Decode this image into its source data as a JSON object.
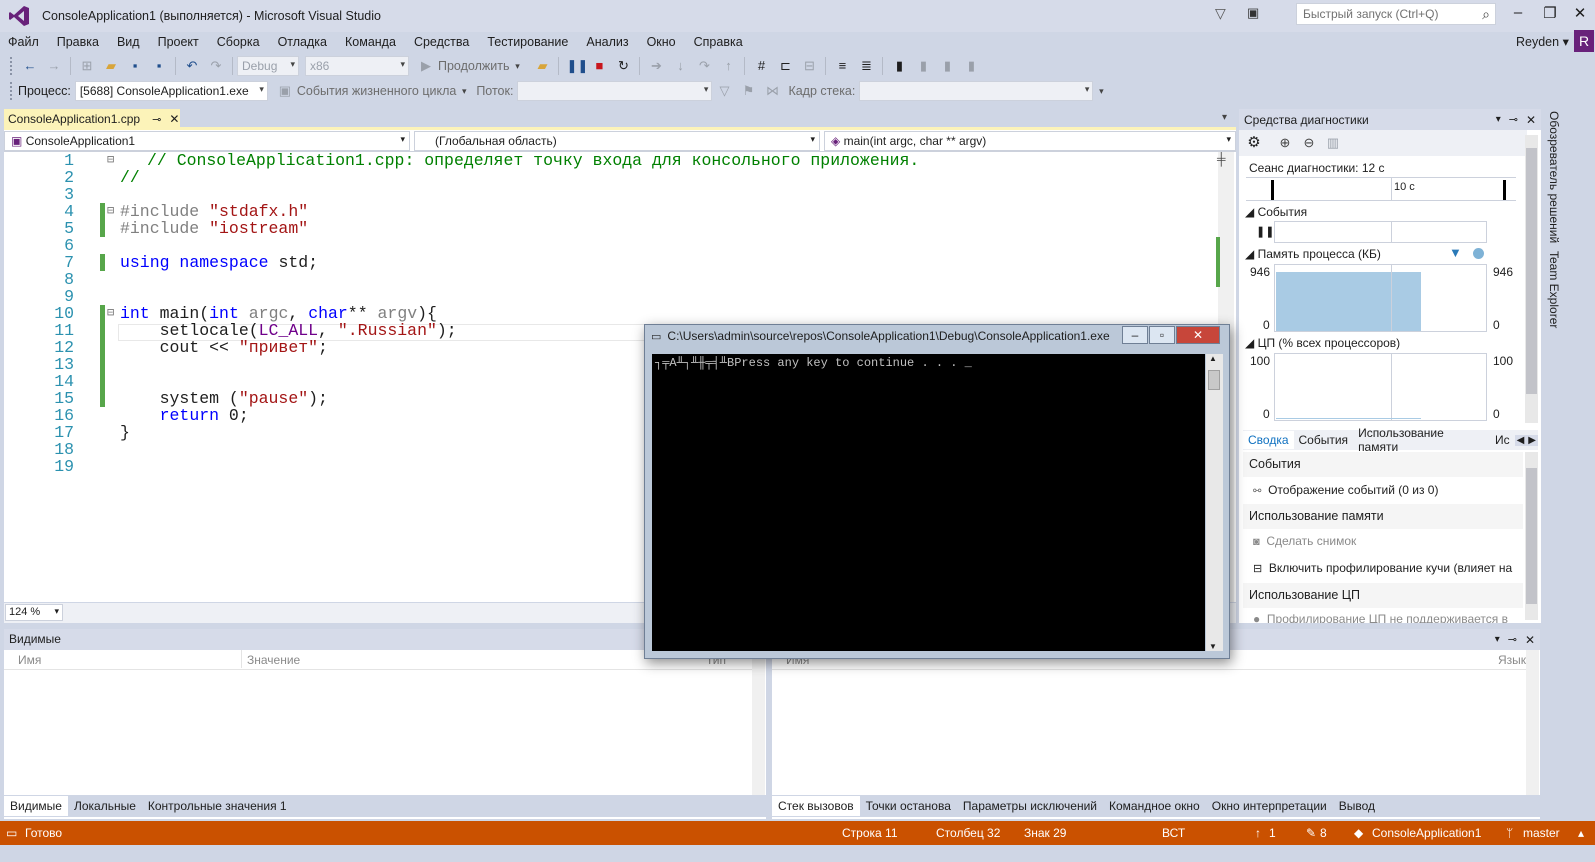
{
  "window": {
    "title": "ConsoleApplication1 (выполняется) - Microsoft Visual Studio",
    "quick_launch_placeholder": "Быстрый запуск (Ctrl+Q)",
    "user": "Reyden",
    "user_initial": "R"
  },
  "menu": [
    "Файл",
    "Правка",
    "Вид",
    "Проект",
    "Сборка",
    "Отладка",
    "Команда",
    "Средства",
    "Тестирование",
    "Анализ",
    "Окно",
    "Справка"
  ],
  "toolbar": {
    "config": "Debug",
    "platform": "x86",
    "continue_label": "Продолжить"
  },
  "debug_location": {
    "process_label": "Процесс:",
    "process_value": "[5688] ConsoleApplication1.exe",
    "lifecycle_label": "События жизненного цикла",
    "thread_label": "Поток:",
    "stack_frame_label": "Кадр стека:"
  },
  "editor": {
    "tab_title": "ConsoleApplication1.cpp",
    "project_combo": "ConsoleApplication1",
    "scope_combo": "(Глобальная область)",
    "member_combo": "main(int argc, char ** argv)",
    "zoom": "124 %",
    "line_numbers": [
      "1",
      "2",
      "3",
      "4",
      "5",
      "6",
      "7",
      "8",
      "9",
      "10",
      "11",
      "12",
      "13",
      "14",
      "15",
      "16",
      "17",
      "18",
      "19"
    ]
  },
  "diagnostics": {
    "title": "Средства диагностики",
    "session": "Сеанс диагностики: 12 с",
    "timeline_tick": "10 с",
    "events_section": "События",
    "memory_section": "Память процесса (КБ)",
    "memory_max_left": "946",
    "memory_min_left": "0",
    "memory_max_right": "946",
    "memory_min_right": "0",
    "memory_fill_fraction": 0.9,
    "cpu_section": "ЦП (% всех процессоров)",
    "cpu_max_left": "100",
    "cpu_min_left": "0",
    "cpu_max_right": "100",
    "cpu_min_right": "0",
    "tabs": [
      "Сводка",
      "События",
      "Использование памяти",
      "Ис"
    ],
    "summary": {
      "events_header": "События",
      "events_item": "Отображение событий (0 из 0)",
      "memory_header": "Использование памяти",
      "snapshot": "Сделать снимок",
      "heap_profiling": "Включить профилирование кучи (влияет на",
      "cpu_header": "Использование ЦП",
      "cpu_note": "Профилирование ЦП не поддерживается в"
    }
  },
  "sidebar": {
    "solution_explorer": "Обозреватель решений",
    "team_explorer": "Team Explorer"
  },
  "locals_panel": {
    "title": "Видимые",
    "col_name": "Имя",
    "col_value": "Значение",
    "col_type": "Тип",
    "tabs": [
      "Видимые",
      "Локальные",
      "Контрольные значения 1"
    ]
  },
  "callstack_panel": {
    "col_name": "Имя",
    "col_lang": "Язык",
    "tabs": [
      "Стек вызовов",
      "Точки останова",
      "Параметры исключений",
      "Командное окно",
      "Окно интерпретации",
      "Вывод"
    ]
  },
  "status": {
    "ready": "Готово",
    "line": "Строка 11",
    "col": "Столбец 32",
    "ch": "Знак 29",
    "mode": "ВСТ",
    "up": "1",
    "edits": "8",
    "repo": "ConsoleApplication1",
    "branch": "master"
  },
  "console": {
    "title": "C:\\Users\\admin\\source\\repos\\ConsoleApplication1\\Debug\\ConsoleApplication1.exe",
    "output": "┐╤A╨┐╨╫╤╡╨BPress any key to continue . . . _"
  }
}
